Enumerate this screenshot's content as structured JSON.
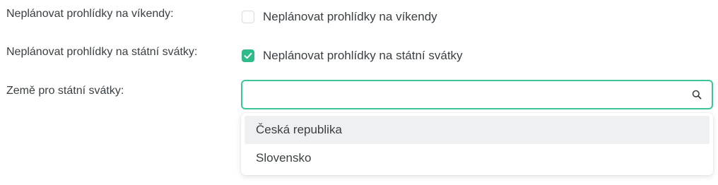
{
  "weekends": {
    "label": "Neplánovat prohlídky na víkendy:",
    "checkbox_label": "Neplánovat prohlídky na víkendy",
    "checked": false
  },
  "holidays": {
    "label": "Neplánovat prohlídky na státní svátky:",
    "checkbox_label": "Neplánovat prohlídky na státní svátky",
    "checked": true
  },
  "country": {
    "label": "Země pro státní svátky:",
    "value": "",
    "options": [
      "Česká republika",
      "Slovensko"
    ],
    "highlighted_option": 0
  },
  "colors": {
    "accent": "#2fba8a",
    "focus_border": "#3cc59b",
    "option_hover": "#eff0f2"
  },
  "icons": {
    "checkmark": "check-icon",
    "search": "search-icon"
  }
}
